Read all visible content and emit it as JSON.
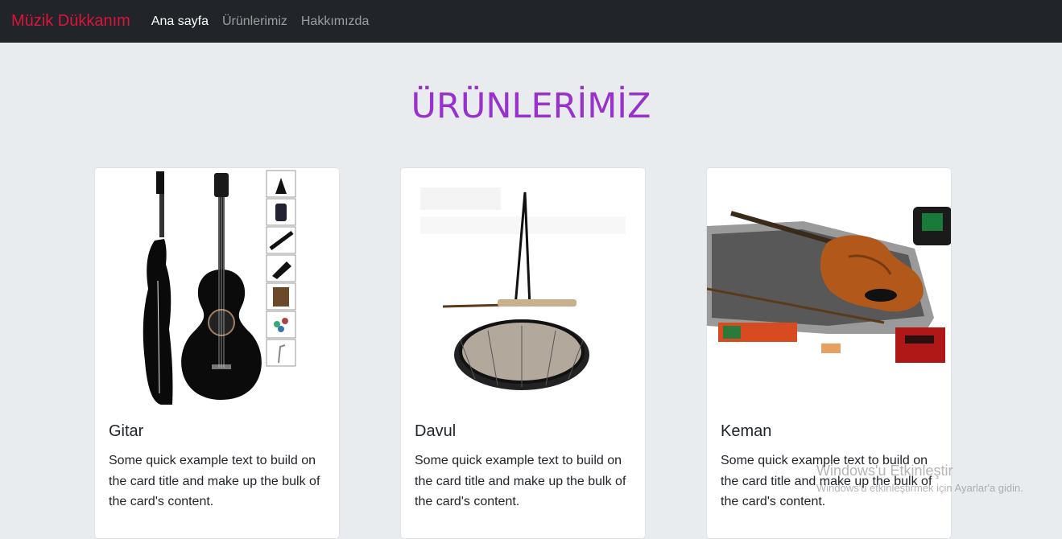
{
  "navbar": {
    "brand": "Müzik Dükkanım",
    "links": [
      {
        "label": "Ana sayfa",
        "active": true
      },
      {
        "label": "Ürünlerimiz",
        "active": false
      },
      {
        "label": "Hakkımızda",
        "active": false
      }
    ]
  },
  "page_title": "ÜRÜNLERİMİZ",
  "cards": [
    {
      "title": "Gitar",
      "text": "Some quick example text to build on the card title and make up the bulk of the card's content.",
      "image_icon": "guitar-image"
    },
    {
      "title": "Davul",
      "text": "Some quick example text to build on the card title and make up the bulk of the card's content.",
      "image_icon": "drum-image"
    },
    {
      "title": "Keman",
      "text": "Some quick example text to build on the card title and make up the bulk of the card's content.",
      "image_icon": "violin-image"
    }
  ],
  "watermark": {
    "title": "Windows'u Etkinleştir",
    "subtitle": "Windows'u etkinleştirmek için Ayarlar'a gidin."
  },
  "colors": {
    "brand": "#dc143c",
    "title": "#9932cc",
    "navbar_bg": "#212529",
    "page_bg": "#e9ecef"
  }
}
